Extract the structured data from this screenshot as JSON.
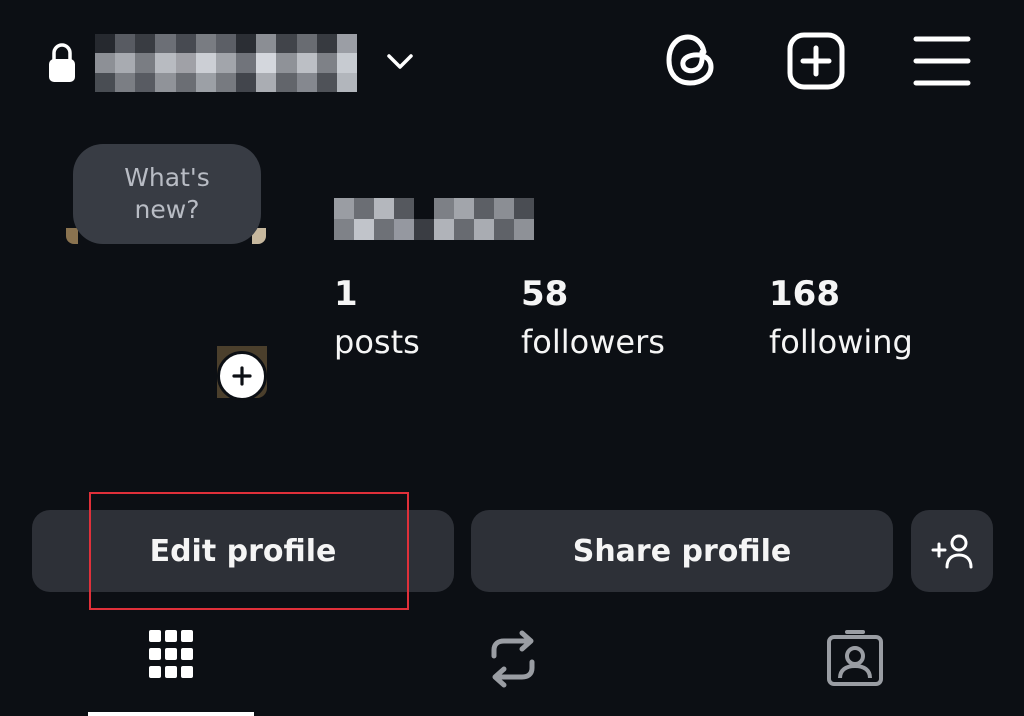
{
  "header": {
    "username_redacted": true,
    "icons": [
      "lock-icon",
      "chevron-down-icon",
      "threads-icon",
      "create-icon",
      "menu-icon"
    ]
  },
  "profile": {
    "note": "What's new?",
    "display_name_redacted": true
  },
  "stats": [
    {
      "value": "1",
      "label": "posts"
    },
    {
      "value": "58",
      "label": "followers"
    },
    {
      "value": "168",
      "label": "following"
    }
  ],
  "actions": {
    "edit_profile": "Edit profile",
    "share_profile": "Share profile"
  },
  "tabs": [
    {
      "icon": "grid-icon",
      "selected": true
    },
    {
      "icon": "reposts-icon",
      "selected": false
    },
    {
      "icon": "tagged-icon",
      "selected": false
    }
  ],
  "colors": {
    "background": "#0c0f14",
    "button": "#2d3037",
    "note_bubble": "#383c44",
    "highlight": "#e0303a",
    "text": "#f5f5f5"
  }
}
